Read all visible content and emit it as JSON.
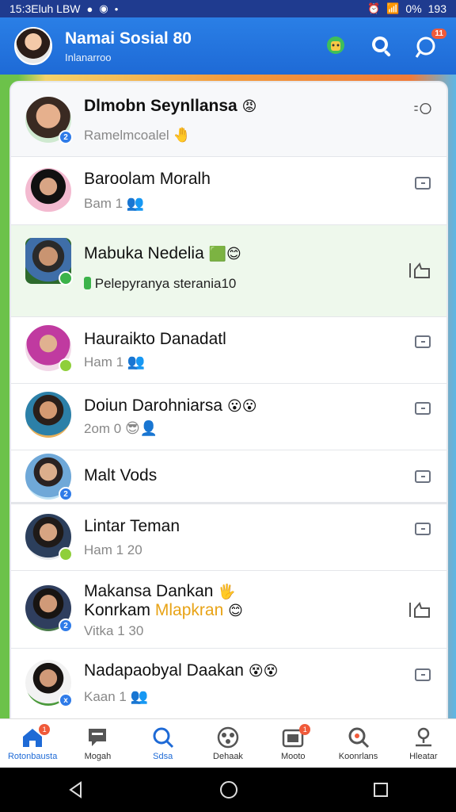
{
  "statusbar": {
    "time": "15:3Eluh LBW",
    "battery": "0%",
    "right_text": "193"
  },
  "header": {
    "title": "Namai Sosial 80",
    "subtitle": "Inlanarroo",
    "notif_badge": "11"
  },
  "chats": [
    {
      "name": "Dlmobn Seynllansa",
      "emoji": "😡",
      "sub": "Ramelmcoalel",
      "sub_emoji": "🤚",
      "badge": "2",
      "badge_color": "#2f7be8",
      "action": "status-ring"
    },
    {
      "name": "Baroolam Moralh",
      "emoji": "",
      "sub": "Bam 1",
      "sub_emoji": "👥",
      "badge": "",
      "badge_color": "",
      "action": "chat"
    },
    {
      "name": "Mabuka Nedelia",
      "emoji": "🟩😊",
      "sub": "Pelepyranya sterania10",
      "sub_emoji": "",
      "badge": "",
      "badge_color": "#3bb34a",
      "action": "like"
    },
    {
      "name": "Hauraikto Danadatl",
      "emoji": "",
      "sub": "Ham 1",
      "sub_emoji": "👥",
      "badge": "",
      "badge_color": "#8fcf3a",
      "action": "chat"
    },
    {
      "name": "Doiun Darohniarsa",
      "emoji": "😮😮",
      "sub": "2om 0",
      "sub_emoji": "😎👤",
      "badge": "",
      "badge_color": "",
      "action": "chat"
    },
    {
      "name": "Malt Vods",
      "emoji": "",
      "sub": "",
      "sub_emoji": "",
      "badge": "2",
      "badge_color": "#2f7be8",
      "action": "chat"
    },
    {
      "name": "Lintar Teman",
      "emoji": "",
      "sub": "Ham 1 20",
      "sub_emoji": "",
      "badge": "",
      "badge_color": "#8fcf3a",
      "action": "chat"
    },
    {
      "name": "Makansa Dankan",
      "name2": "Konrkam",
      "name2_highlight": "Mlapkran",
      "emoji": "🖐",
      "emoji2": "😊",
      "sub": "Vitka 1 30",
      "sub_emoji": "",
      "badge": "2",
      "badge_color": "#2f7be8",
      "action": "like"
    },
    {
      "name": "Nadapaobyal Daakan",
      "emoji": "😵😵",
      "sub": "Kaan 1",
      "sub_emoji": "👥",
      "badge": "x",
      "badge_color": "#2f7be8",
      "action": "chat"
    }
  ],
  "bottomnav": [
    {
      "label": "Rotonbausta",
      "icon": "home-icon",
      "badge": "1"
    },
    {
      "label": "Mogah",
      "icon": "message-icon",
      "badge": ""
    },
    {
      "label": "Sdsa",
      "icon": "search-icon",
      "badge": ""
    },
    {
      "label": "Dehaak",
      "icon": "group-icon",
      "badge": ""
    },
    {
      "label": "Mooto",
      "icon": "photo-icon",
      "badge": "1"
    },
    {
      "label": "Koonrlans",
      "icon": "explore-icon",
      "badge": ""
    },
    {
      "label": "Hleatar",
      "icon": "profile-icon",
      "badge": ""
    }
  ],
  "colors": {
    "accent": "#1e6ad6",
    "header_bg": "#2a7fe6",
    "badge": "#f05a3a"
  }
}
